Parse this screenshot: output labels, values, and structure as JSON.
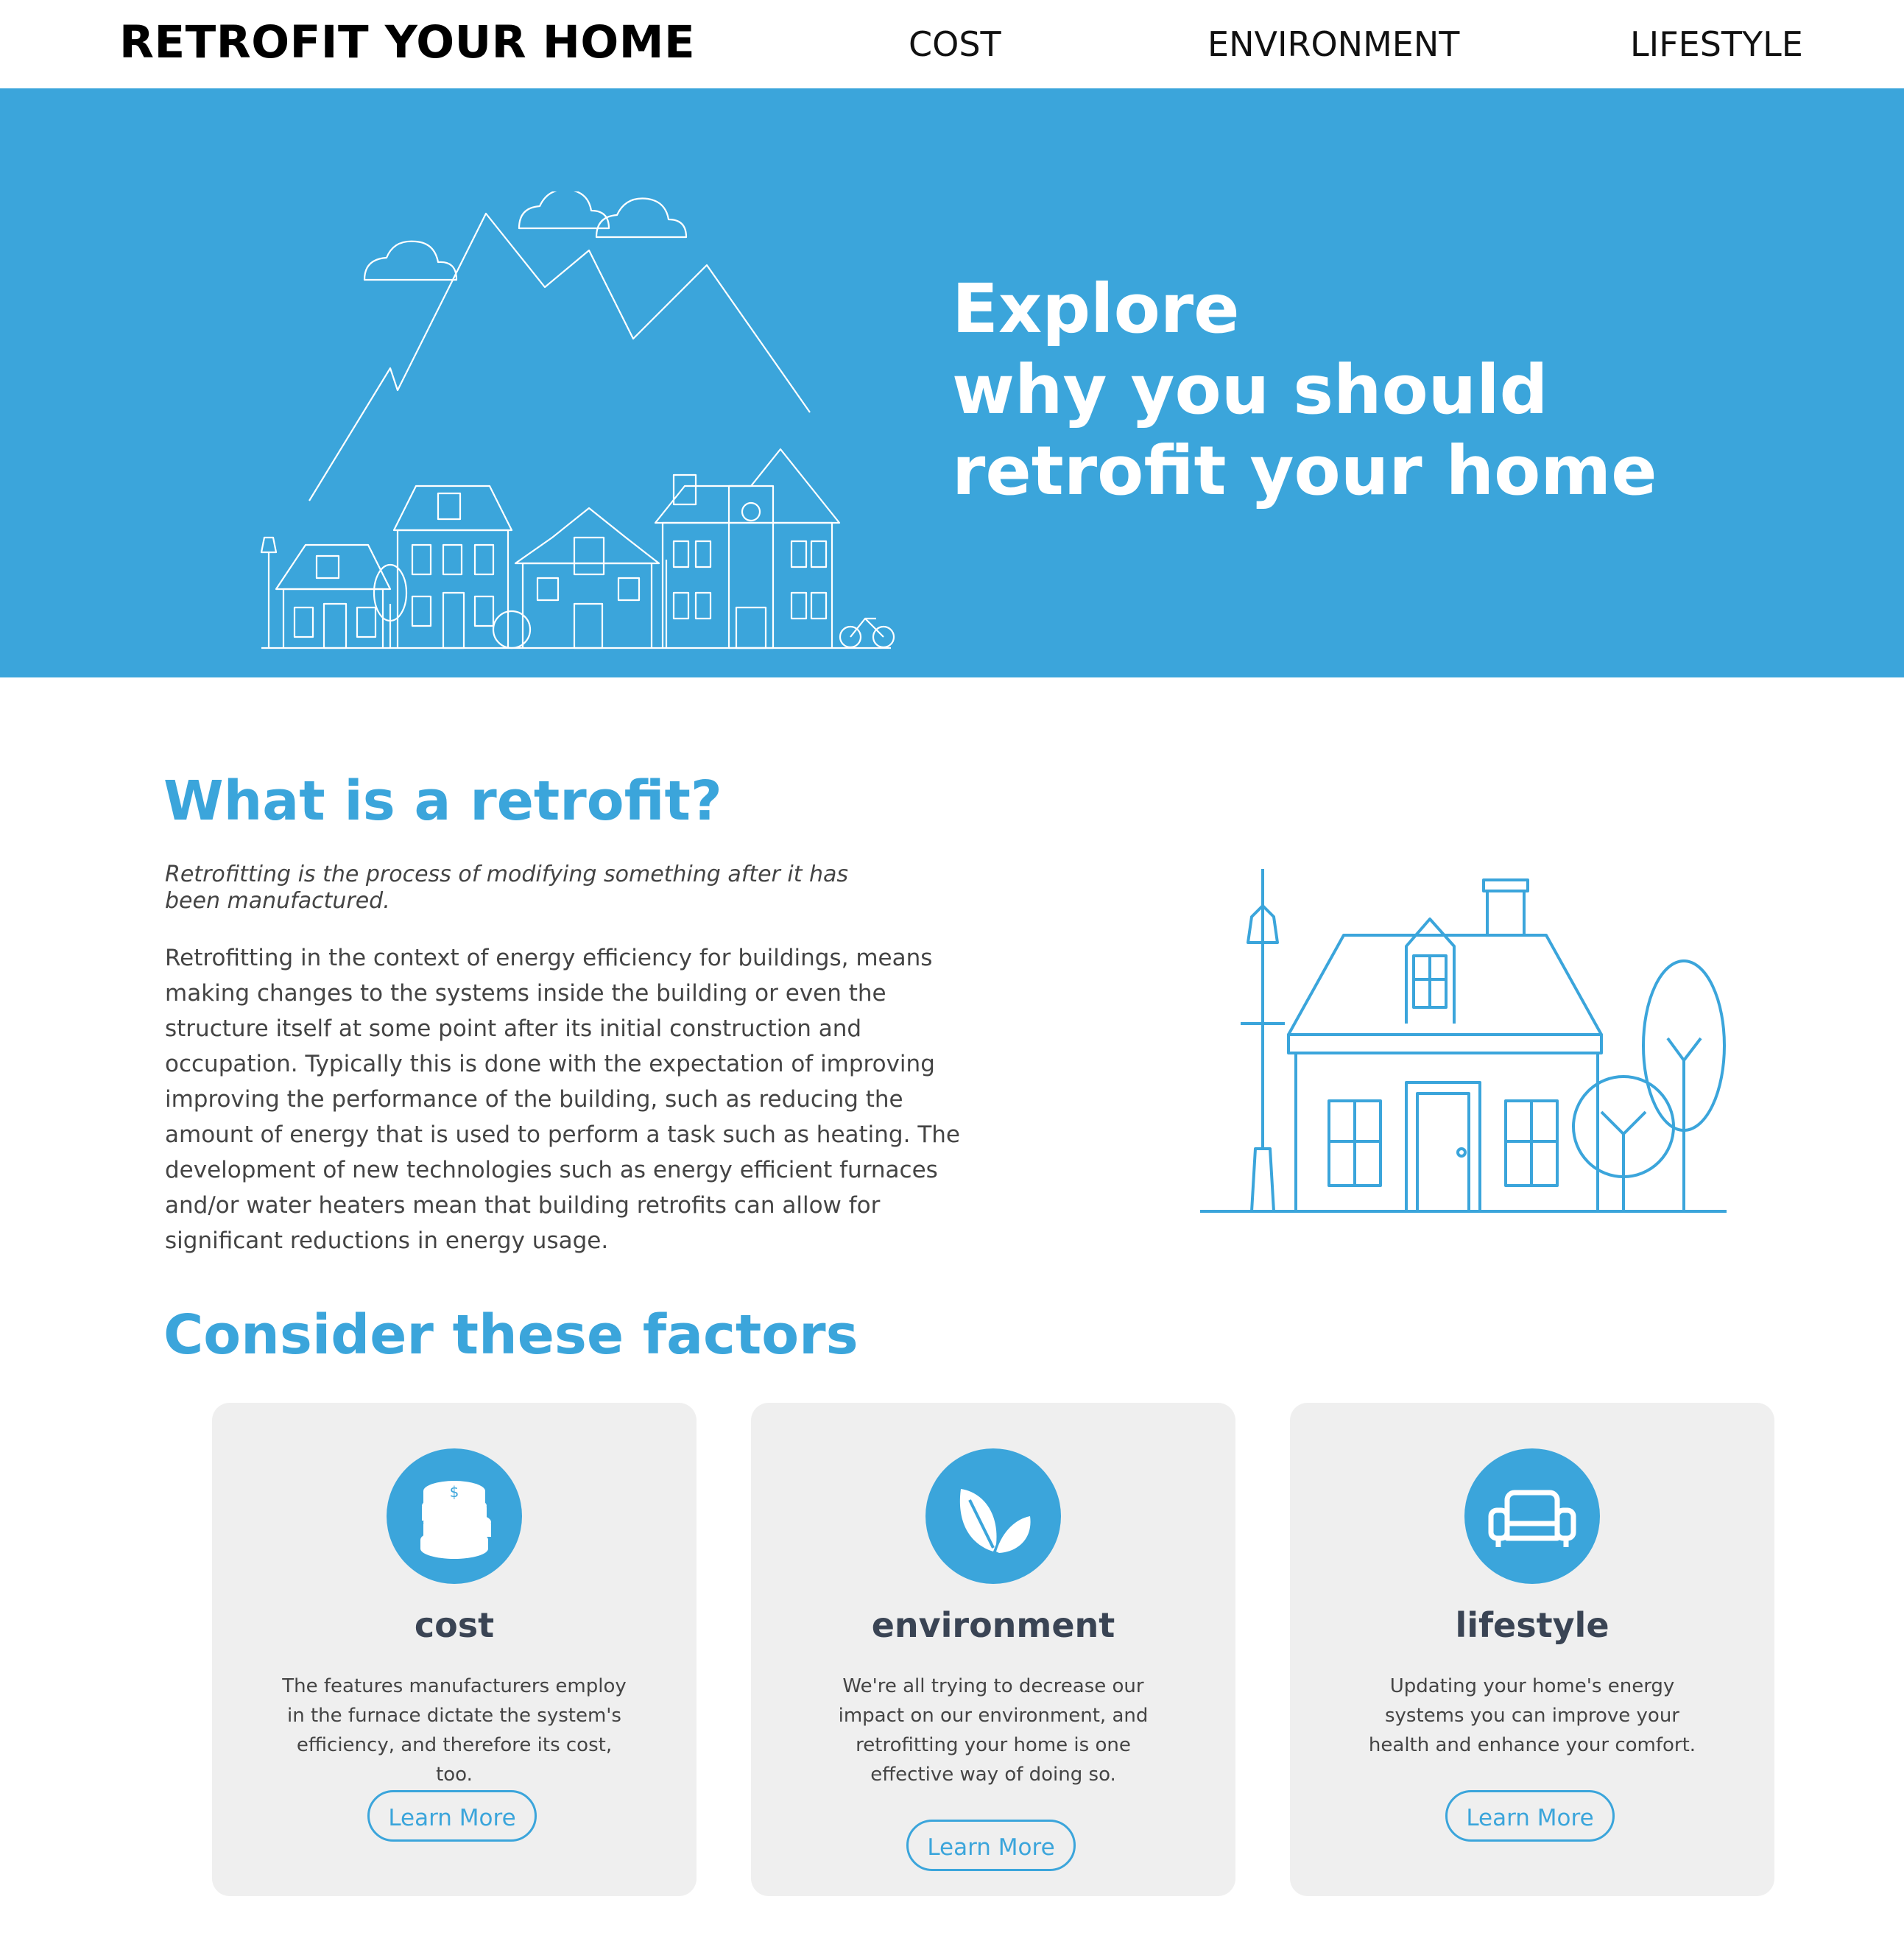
{
  "nav": {
    "brand": "RETROFIT YOUR HOME",
    "links": [
      "COST",
      "ENVIRONMENT",
      "LIFESTYLE"
    ]
  },
  "hero": {
    "line1": "Explore",
    "line2": "why you should",
    "line3": "retrofit your home",
    "bg_color": "#3ba5db"
  },
  "about": {
    "title": "What is a retrofit?",
    "lead": "Retrofitting is the process of modifying something after it has been manufactured.",
    "body": "Retrofitting in the context of energy efficiency for buildings, means making changes to the systems inside the building or even the structure itself at some point after its initial construction and occupation. Typically this is done with the expectation of improving improving the performance of the building, such as reducing the amount of energy that is used to perform a task such as heating. The development of new technologies such as energy efficient furnaces and/or water heaters mean that building retrofits can allow for significant reductions in energy usage."
  },
  "factors": {
    "title": "Consider these factors",
    "cards": [
      {
        "icon": "coins-icon",
        "title": "cost",
        "text": "The features manufacturers employ in the furnace dictate the system's efficiency, and therefore its cost, too.",
        "button": "Learn More"
      },
      {
        "icon": "leaves-icon",
        "title": "environment",
        "text": "We're all trying to decrease our impact on our environment, and retrofitting your home is one effective way of doing so.",
        "button": "Learn More"
      },
      {
        "icon": "sofa-icon",
        "title": "lifestyle",
        "text": "Updating your home's energy systems you can improve your health and enhance your comfort.",
        "button": "Learn More"
      }
    ]
  },
  "colors": {
    "accent": "#3ba5db",
    "card_bg": "#efefef",
    "card_title": "#3a4454"
  }
}
